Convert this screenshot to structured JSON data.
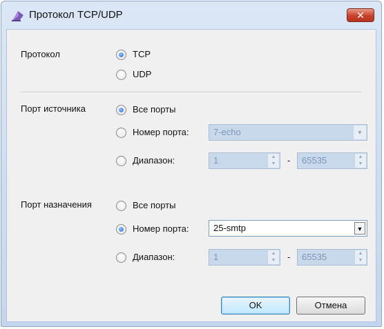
{
  "window": {
    "title": "Протокол TCP/UDP",
    "close_icon": "close-icon"
  },
  "protocol": {
    "label": "Протокол",
    "options": [
      "TCP",
      "UDP"
    ],
    "selected": "TCP"
  },
  "source_port": {
    "label": "Порт источника",
    "all_ports_label": "Все порты",
    "port_number_label": "Номер порта:",
    "port_number_value": "7-echo",
    "range_label": "Диапазон:",
    "range_from": "1",
    "range_to": "65535",
    "range_dash": "-",
    "selected": "all"
  },
  "destination_port": {
    "label": "Порт назначения",
    "all_ports_label": "Все порты",
    "port_number_label": "Номер порта:",
    "port_number_value": "25-smtp",
    "range_label": "Диапазон:",
    "range_from": "1",
    "range_to": "65535",
    "range_dash": "-",
    "selected": "port"
  },
  "buttons": {
    "ok": "OK",
    "cancel": "Отмена"
  }
}
